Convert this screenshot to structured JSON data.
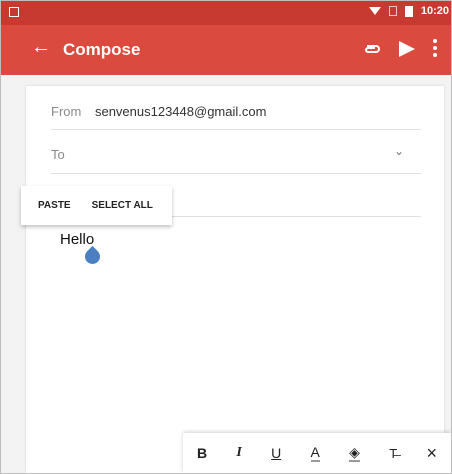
{
  "status_bar": {
    "time": "10:20"
  },
  "app_bar": {
    "title": "Compose",
    "icons": [
      "back-arrow-icon",
      "attachment-icon",
      "send-icon",
      "more-vert-icon"
    ]
  },
  "compose": {
    "from_label": "From",
    "from_value": "senvenus123448@gmail.com",
    "to_label": "To",
    "body_text": "Hello"
  },
  "context_menu": {
    "paste_label": "PASTE",
    "select_all_label": "SELECT ALL"
  },
  "format_toolbar": {
    "bold_label": "B",
    "italic_label": "I",
    "underline_label": "U",
    "text_color_label": "A",
    "fill_icon_label": "◈",
    "clear_format_label": "T̶",
    "close_label": "×"
  },
  "colors": {
    "status_bar": "#c73a32",
    "app_bar": "#da4a3e",
    "cursor_handle": "#4a7fc1"
  }
}
